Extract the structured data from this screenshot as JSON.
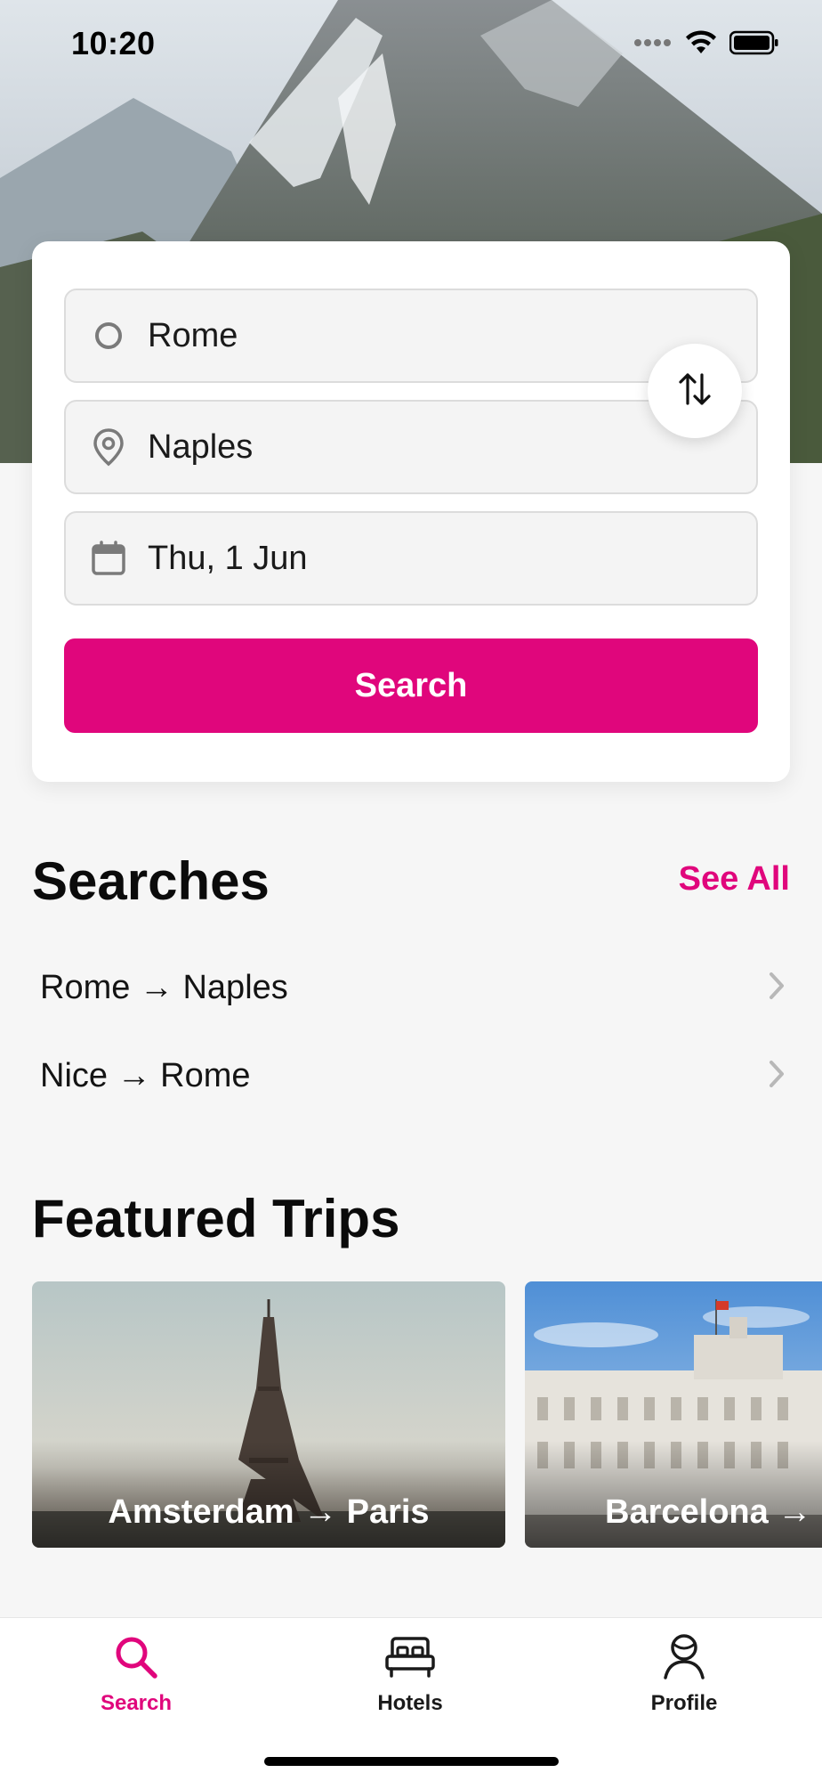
{
  "status_bar": {
    "time": "10:20"
  },
  "search_form": {
    "origin": "Rome",
    "destination": "Naples",
    "date": "Thu, 1 Jun",
    "search_label": "Search"
  },
  "recent_searches": {
    "title": "Searches",
    "see_all_label": "See All",
    "items": [
      {
        "label": "Rome → Naples"
      },
      {
        "label": "Nice → Rome"
      }
    ]
  },
  "featured": {
    "title": "Featured Trips",
    "trips": [
      {
        "label": "Amsterdam → Paris"
      },
      {
        "label": "Barcelona → M"
      }
    ]
  },
  "tab_bar": {
    "tabs": [
      {
        "label": "Search",
        "icon": "search-icon",
        "active": true
      },
      {
        "label": "Hotels",
        "icon": "bed-icon",
        "active": false
      },
      {
        "label": "Profile",
        "icon": "person-icon",
        "active": false
      }
    ]
  },
  "colors": {
    "accent": "#e0067c",
    "background": "#f6f6f6",
    "card": "#ffffff"
  }
}
